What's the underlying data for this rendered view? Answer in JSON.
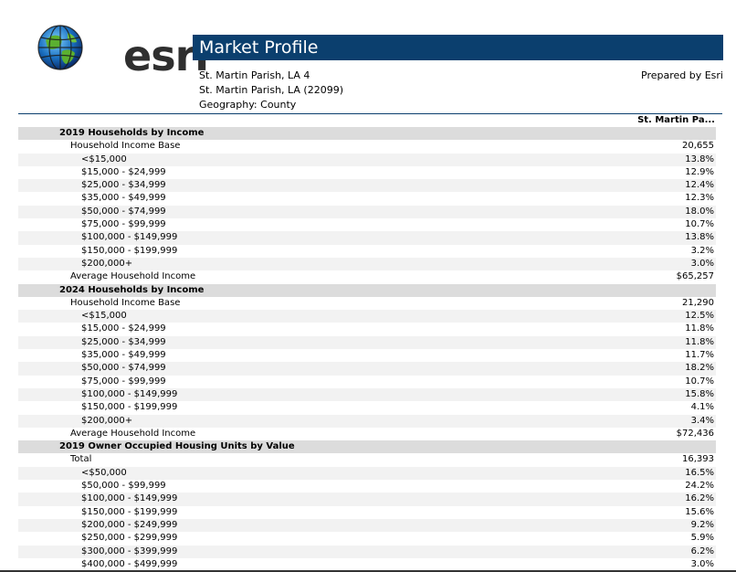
{
  "header": {
    "logo_text": "esri",
    "title": "Market Profile",
    "location_line1": "St. Martin Parish, LA 4",
    "location_line2": "St. Martin Parish, LA (22099)",
    "geography": "Geography: County",
    "prepared_by": "Prepared by Esri",
    "column_header": "St. Martin Pa..."
  },
  "rows": [
    {
      "label": "2019 Households by Income",
      "value": "",
      "type": "section"
    },
    {
      "label": "Household Income Base",
      "value": "20,655",
      "type": "l1"
    },
    {
      "label": "<$15,000",
      "value": "13.8%",
      "type": "l2"
    },
    {
      "label": "$15,000 - $24,999",
      "value": "12.9%",
      "type": "l2"
    },
    {
      "label": "$25,000 - $34,999",
      "value": "12.4%",
      "type": "l2"
    },
    {
      "label": "$35,000 - $49,999",
      "value": "12.3%",
      "type": "l2"
    },
    {
      "label": "$50,000 - $74,999",
      "value": "18.0%",
      "type": "l2"
    },
    {
      "label": "$75,000 - $99,999",
      "value": "10.7%",
      "type": "l2"
    },
    {
      "label": "$100,000 - $149,999",
      "value": "13.8%",
      "type": "l2"
    },
    {
      "label": "$150,000 - $199,999",
      "value": "3.2%",
      "type": "l2"
    },
    {
      "label": "$200,000+",
      "value": "3.0%",
      "type": "l2"
    },
    {
      "label": "Average Household Income",
      "value": "$65,257",
      "type": "l1"
    },
    {
      "label": "2024 Households by Income",
      "value": "",
      "type": "section"
    },
    {
      "label": "Household Income Base",
      "value": "21,290",
      "type": "l1"
    },
    {
      "label": "<$15,000",
      "value": "12.5%",
      "type": "l2"
    },
    {
      "label": "$15,000 - $24,999",
      "value": "11.8%",
      "type": "l2"
    },
    {
      "label": "$25,000 - $34,999",
      "value": "11.8%",
      "type": "l2"
    },
    {
      "label": "$35,000 - $49,999",
      "value": "11.7%",
      "type": "l2"
    },
    {
      "label": "$50,000 - $74,999",
      "value": "18.2%",
      "type": "l2"
    },
    {
      "label": "$75,000 - $99,999",
      "value": "10.7%",
      "type": "l2"
    },
    {
      "label": "$100,000 - $149,999",
      "value": "15.8%",
      "type": "l2"
    },
    {
      "label": "$150,000 - $199,999",
      "value": "4.1%",
      "type": "l2"
    },
    {
      "label": "$200,000+",
      "value": "3.4%",
      "type": "l2"
    },
    {
      "label": "Average Household Income",
      "value": "$72,436",
      "type": "l1"
    },
    {
      "label": "2019 Owner Occupied Housing Units by Value",
      "value": "",
      "type": "section"
    },
    {
      "label": "Total",
      "value": "16,393",
      "type": "l1"
    },
    {
      "label": "<$50,000",
      "value": "16.5%",
      "type": "l2"
    },
    {
      "label": "$50,000 - $99,999",
      "value": "24.2%",
      "type": "l2"
    },
    {
      "label": "$100,000 - $149,999",
      "value": "16.2%",
      "type": "l2"
    },
    {
      "label": "$150,000 - $199,999",
      "value": "15.6%",
      "type": "l2"
    },
    {
      "label": "$200,000 - $249,999",
      "value": "9.2%",
      "type": "l2"
    },
    {
      "label": "$250,000 - $299,999",
      "value": "5.9%",
      "type": "l2"
    },
    {
      "label": "$300,000 - $399,999",
      "value": "6.2%",
      "type": "l2"
    },
    {
      "label": "$400,000 - $499,999",
      "value": "3.0%",
      "type": "l2"
    }
  ],
  "colors": {
    "title_bar": "#0b3f6e",
    "section_bg": "#dcdcdc",
    "alt_row_bg": "#f2f2f2"
  }
}
